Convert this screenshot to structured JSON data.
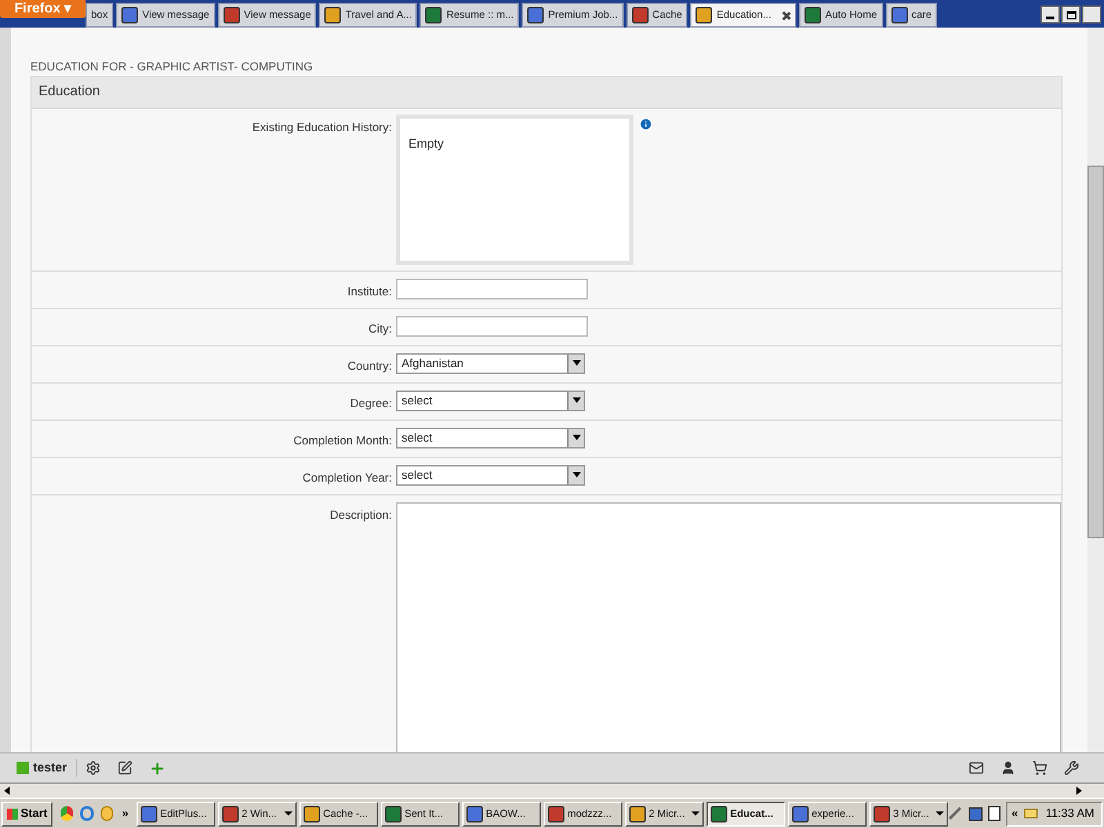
{
  "browser": {
    "menu_button": "Firefox ▾",
    "tabs": [
      {
        "label": "box",
        "selected": false
      },
      {
        "label": "View message",
        "selected": false
      },
      {
        "label": "View message",
        "selected": false
      },
      {
        "label": "Travel and A...",
        "selected": false
      },
      {
        "label": "Resume :: m...",
        "selected": false
      },
      {
        "label": "Premium Job...",
        "selected": false
      },
      {
        "label": "Cache",
        "selected": false
      },
      {
        "label": "Education...",
        "selected": true
      },
      {
        "label": "Auto Home",
        "selected": false
      },
      {
        "label": "care",
        "selected": false
      }
    ]
  },
  "page": {
    "heading": "EDUCATION FOR - GRAPHIC ARTIST- COMPUTING",
    "panel_title": "Education",
    "fields": [
      {
        "kind": "history",
        "label": "Existing Education History:",
        "value": "Empty"
      },
      {
        "kind": "text",
        "label": "Institute:"
      },
      {
        "kind": "text",
        "label": "City:"
      },
      {
        "kind": "select",
        "label": "Country:",
        "value": "Afghanistan"
      },
      {
        "kind": "select",
        "label": "Degree:",
        "value": "select"
      },
      {
        "kind": "select",
        "label": "Completion Month:",
        "value": "select"
      },
      {
        "kind": "select",
        "label": "Completion Year:",
        "value": "select"
      },
      {
        "kind": "textarea",
        "label": "Description:"
      }
    ]
  },
  "addon_bar": {
    "user": "tester"
  },
  "taskbar": {
    "start": "Start",
    "overflow": "»",
    "buttons": [
      {
        "label": "EditPlus...",
        "selected": false,
        "grouped": false
      },
      {
        "label": "2 Win...",
        "selected": false,
        "grouped": true
      },
      {
        "label": "Cache -...",
        "selected": false,
        "grouped": false
      },
      {
        "label": "Sent It...",
        "selected": false,
        "grouped": false
      },
      {
        "label": "BAOW...",
        "selected": false,
        "grouped": false
      },
      {
        "label": "modzzz...",
        "selected": false,
        "grouped": false
      },
      {
        "label": "2 Micr...",
        "selected": false,
        "grouped": true
      },
      {
        "label": "Educat...",
        "selected": true,
        "grouped": false
      },
      {
        "label": "experie...",
        "selected": false,
        "grouped": false
      },
      {
        "label": "3 Micr...",
        "selected": false,
        "grouped": true
      }
    ],
    "tray_expand": "«",
    "clock": "11:33 AM"
  }
}
